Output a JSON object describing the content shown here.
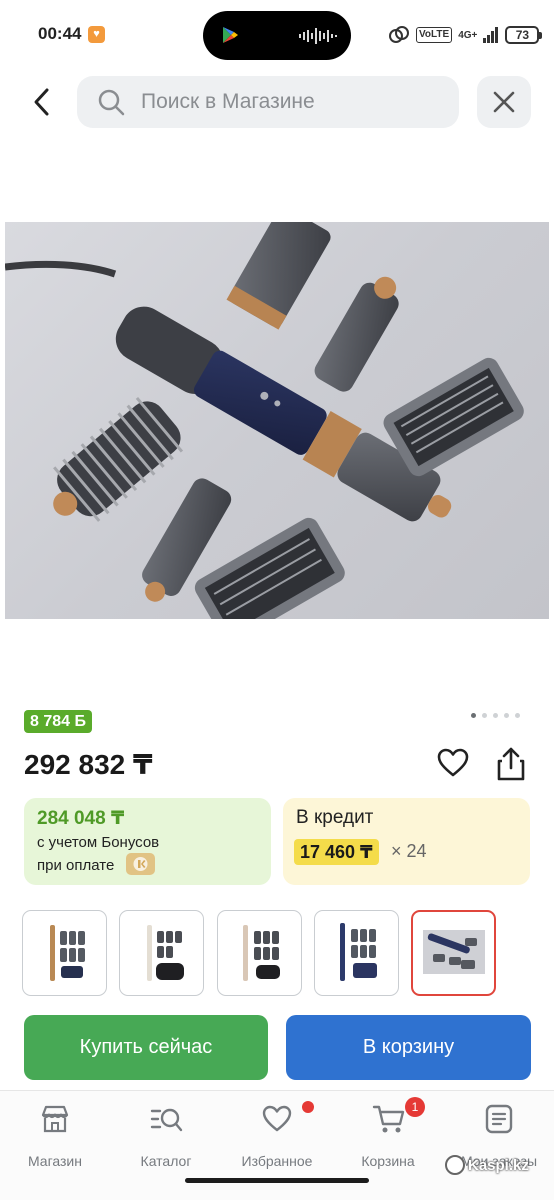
{
  "status_bar": {
    "time": "00:44",
    "volte": "VoLTE",
    "network": "4G+",
    "battery": "73"
  },
  "search": {
    "placeholder": "Поиск в Магазине"
  },
  "product": {
    "image_alt": "dyson-airwrap-set",
    "bonus_badge": "8 784 Б",
    "price": "292 832 ₸",
    "pager_count": 5,
    "pager_active": 0
  },
  "bonus_card": {
    "amount": "284 048 ₸",
    "line1": "с учетом Бонусов",
    "line2": "при оплате"
  },
  "credit_card": {
    "title": "В кредит",
    "amount": "17 460 ₸",
    "months": "× 24"
  },
  "variants": [
    {
      "selected": false
    },
    {
      "selected": false
    },
    {
      "selected": false
    },
    {
      "selected": false
    },
    {
      "selected": true
    }
  ],
  "actions": {
    "buy_now": "Купить сейчас",
    "add_to_cart": "В корзину"
  },
  "bottom_nav": {
    "items": [
      {
        "label": "Магазин",
        "icon": "store-icon"
      },
      {
        "label": "Каталог",
        "icon": "catalog-search-icon"
      },
      {
        "label": "Избранное",
        "icon": "heart-icon"
      },
      {
        "label": "Корзина",
        "icon": "cart-icon"
      },
      {
        "label": "Мои заказы",
        "icon": "orders-icon"
      }
    ],
    "cart_badge": "1"
  },
  "watermark": "Kaspi.kz",
  "colors": {
    "bonus_green": "#5aab2b",
    "buy_green": "#47a955",
    "cart_blue": "#2f72d0",
    "credit_yellow": "#f4dc4a",
    "badge_red": "#e53935"
  }
}
